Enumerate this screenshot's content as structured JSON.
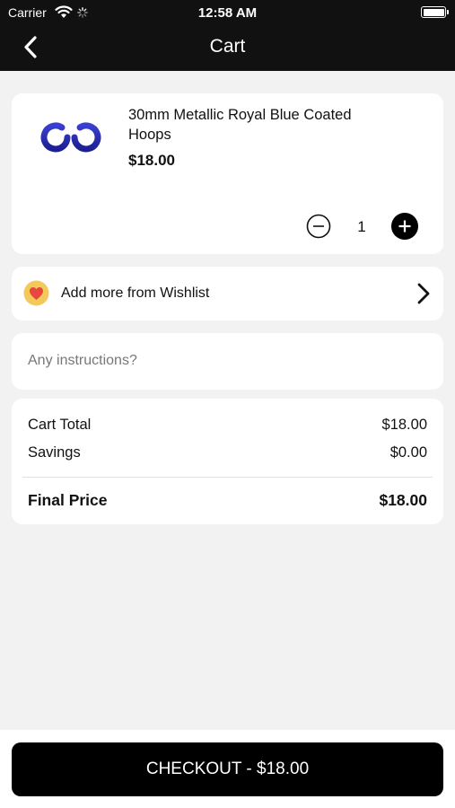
{
  "status_bar": {
    "carrier": "Carrier",
    "time": "12:58 AM",
    "icons": [
      "wifi-icon",
      "activity-spinner-icon",
      "battery-icon"
    ]
  },
  "nav": {
    "title": "Cart",
    "back_icon": "chevron-left-icon"
  },
  "cart_item": {
    "name": "30mm Metallic Royal Blue Coated Hoops",
    "price": "$18.00",
    "quantity": "1",
    "thumbnail_color": "#2a2fb0"
  },
  "wishlist": {
    "label": "Add more from Wishlist",
    "icon": "heart-icon",
    "icon_bg": "#f3c95a",
    "heart_color": "#e8463f"
  },
  "instructions": {
    "placeholder": "Any instructions?",
    "value": ""
  },
  "summary": {
    "cart_total_label": "Cart Total",
    "cart_total_value": "$18.00",
    "savings_label": "Savings",
    "savings_value": "$0.00",
    "final_price_label": "Final Price",
    "final_price_value": "$18.00"
  },
  "checkout": {
    "label": "CHECKOUT - $18.00"
  },
  "colors": {
    "header_bg": "#111111",
    "page_bg": "#f2f2f2",
    "card_bg": "#ffffff",
    "button_bg": "#000000"
  }
}
